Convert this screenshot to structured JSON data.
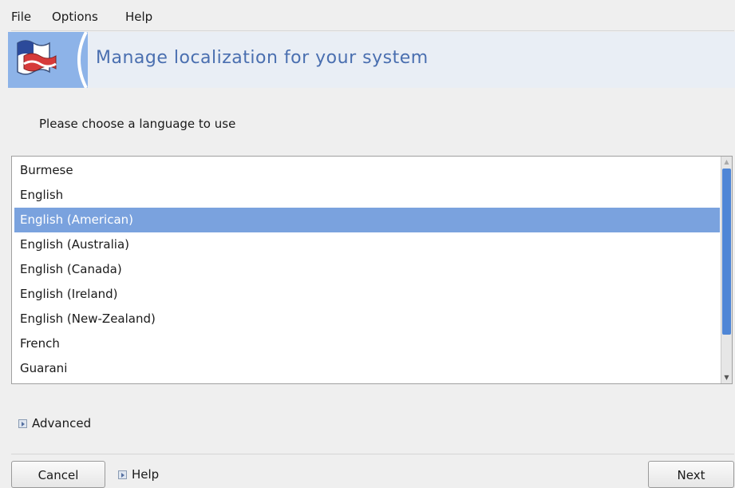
{
  "menu": {
    "file": "File",
    "options": "Options",
    "help": "Help"
  },
  "banner": {
    "title": "Manage localization for your system",
    "icon": "localization-flag-icon"
  },
  "prompt": "Please choose a language to use",
  "languages": [
    "Burmese",
    "English",
    "English (American)",
    "English (Australia)",
    "English (Canada)",
    "English (Ireland)",
    "English (New-Zealand)",
    "French",
    "Guarani"
  ],
  "selected_language": "English (American)",
  "advanced_label": "Advanced",
  "buttons": {
    "cancel": "Cancel",
    "help": "Help",
    "next": "Next"
  },
  "colors": {
    "selection": "#7aa2de",
    "scroll_thumb": "#4f86d6",
    "banner_title": "#4a6fb0"
  }
}
